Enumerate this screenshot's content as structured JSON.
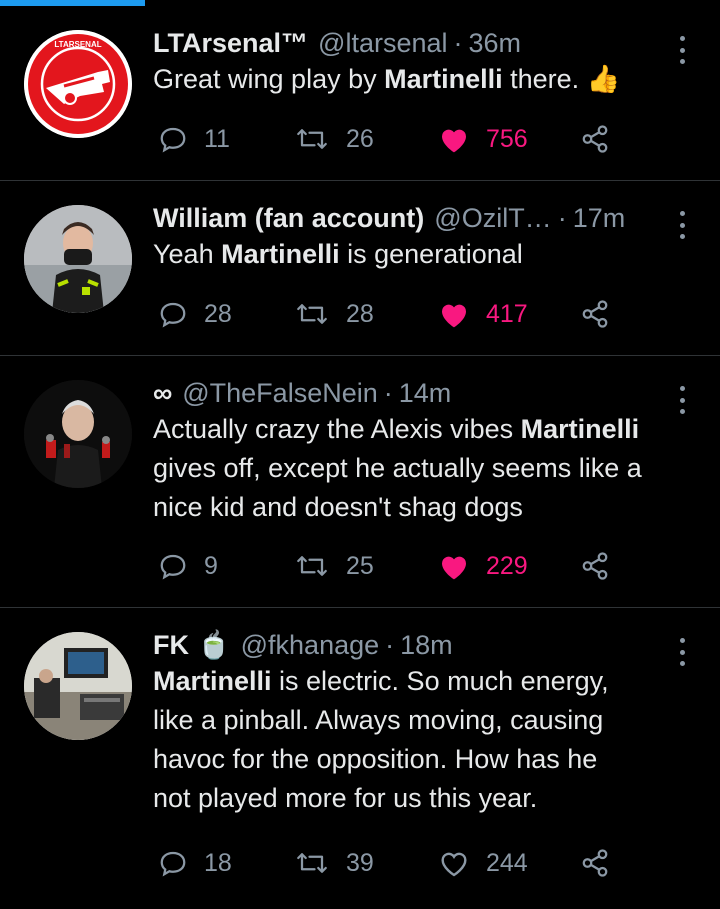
{
  "tweets": [
    {
      "display_name": "LTArsenal™",
      "handle": "@ltarsenal",
      "time": "36m",
      "text_parts": [
        "Great wing play by ",
        "Martinelli",
        " there. 👍"
      ],
      "replies": "11",
      "retweets": "26",
      "likes": "756",
      "liked": true,
      "avatar": "ltarsenal-logo",
      "avatar_text": "LTARSENAL"
    },
    {
      "display_name": "William (fan account)",
      "handle": "@OzilT…",
      "time": "17m",
      "text_parts": [
        "Yeah ",
        "Martinelli",
        " is generational"
      ],
      "replies": "28",
      "retweets": "28",
      "likes": "417",
      "liked": true,
      "avatar": "player-photo"
    },
    {
      "display_name": "∞",
      "handle": "@TheFalseNein",
      "time": "14m",
      "text_lines": [
        [
          "Actually crazy the Alexis vibes ",
          "Martinelli"
        ],
        [
          "gives off, except he actually seems like a",
          ""
        ],
        [
          "nice kid and doesn't shag dogs",
          ""
        ]
      ],
      "replies": "9",
      "retweets": "25",
      "likes": "229",
      "liked": true,
      "avatar": "manager-photo"
    },
    {
      "display_name": "FK",
      "emoji": "🍵",
      "handle": "@fkhanage",
      "time": "18m",
      "text_lines": [
        [
          "",
          "Martinelli",
          " is electric. So much energy,"
        ],
        [
          "like a pinball. Always moving, causing",
          "",
          ""
        ],
        [
          "havoc for the opposition. How has he",
          "",
          ""
        ],
        [
          "not played more for us this year.",
          "",
          ""
        ]
      ],
      "replies": "18",
      "retweets": "39",
      "likes": "244",
      "liked": false,
      "avatar": "studio-photo"
    }
  ],
  "colors": {
    "background": "#000000",
    "like": "#f91880",
    "muted": "#8b98a5",
    "accent": "#1d9bf0",
    "divider": "#2f3336"
  },
  "icons": {
    "reply": "reply-icon",
    "retweet": "retweet-icon",
    "like": "heart-icon",
    "share": "share-icon",
    "more": "more-options-icon"
  }
}
